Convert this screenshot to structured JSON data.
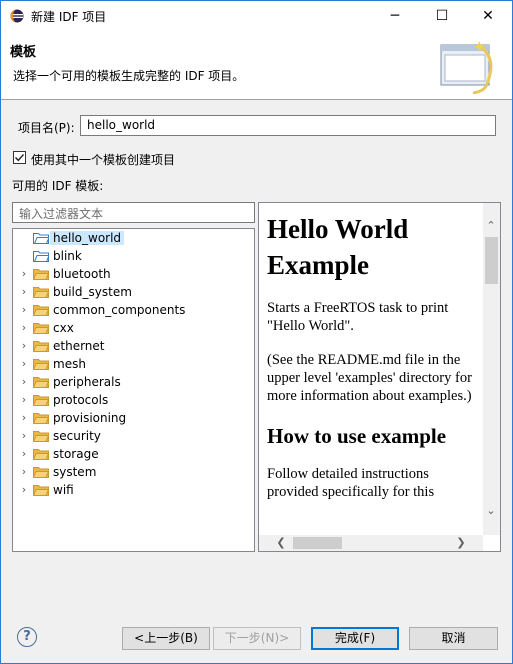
{
  "window": {
    "title": "新建 IDF 项目",
    "minimize": "─",
    "maximize": "☐",
    "close": "✕"
  },
  "header": {
    "title": "模板",
    "description": "选择一个可用的模板生成完整的 IDF 项目。"
  },
  "form": {
    "project_name_label": "项目名(P):",
    "project_name_value": "hello_world",
    "use_template_label": "使用其中一个模板创建项目",
    "use_template_checked": true,
    "available_templates_label": "可用的 IDF 模板:",
    "filter_placeholder": "输入过滤器文本"
  },
  "tree": {
    "items": [
      {
        "label": "hello_world",
        "expandable": false,
        "selected": true
      },
      {
        "label": "blink",
        "expandable": false,
        "selected": false
      },
      {
        "label": "bluetooth",
        "expandable": true,
        "selected": false
      },
      {
        "label": "build_system",
        "expandable": true,
        "selected": false
      },
      {
        "label": "common_components",
        "expandable": true,
        "selected": false
      },
      {
        "label": "cxx",
        "expandable": true,
        "selected": false
      },
      {
        "label": "ethernet",
        "expandable": true,
        "selected": false
      },
      {
        "label": "mesh",
        "expandable": true,
        "selected": false
      },
      {
        "label": "peripherals",
        "expandable": true,
        "selected": false
      },
      {
        "label": "protocols",
        "expandable": true,
        "selected": false
      },
      {
        "label": "provisioning",
        "expandable": true,
        "selected": false
      },
      {
        "label": "security",
        "expandable": true,
        "selected": false
      },
      {
        "label": "storage",
        "expandable": true,
        "selected": false
      },
      {
        "label": "system",
        "expandable": true,
        "selected": false
      },
      {
        "label": "wifi",
        "expandable": true,
        "selected": false
      }
    ]
  },
  "preview": {
    "heading": "Hello World Example",
    "para1": "Starts a FreeRTOS task to print \"Hello World\".",
    "para2": "(See the README.md file in the upper level 'examples' directory for more information about examples.)",
    "heading2": "How to use example",
    "para3": "Follow detailed instructions provided specifically for this"
  },
  "buttons": {
    "back": "<上一步(B)",
    "next": "下一步(N)>",
    "finish": "完成(F)",
    "cancel": "取消"
  },
  "icons": {
    "help": "?",
    "chevron_up": "⌃",
    "chevron_down": "⌄",
    "arrow_left": "❮",
    "arrow_right": "❯",
    "tree_expand": "›"
  },
  "colors": {
    "selection": "#cce8ff",
    "default_button_border": "#0078d7",
    "window_border": "#2b79d8"
  }
}
